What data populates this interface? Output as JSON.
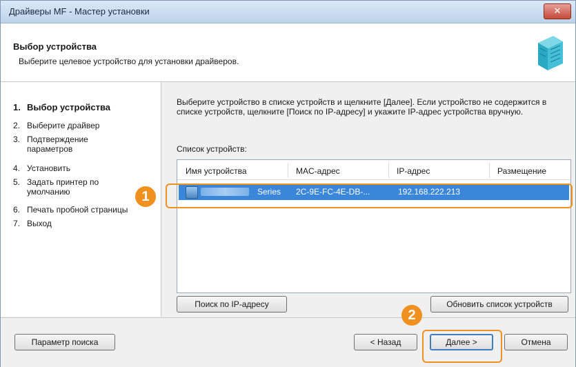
{
  "window": {
    "title": "Драйверы MF - Мастер установки",
    "close_label": "✕"
  },
  "header": {
    "title": "Выбор устройства",
    "subtitle": "Выберите целевое устройство для установки драйверов."
  },
  "steps": [
    {
      "num": "1.",
      "label": "Выбор устройства"
    },
    {
      "num": "2.",
      "label": "Выберите драйвер"
    },
    {
      "num": "3.",
      "label": "Подтверждение параметров"
    },
    {
      "num": "4.",
      "label": "Установить"
    },
    {
      "num": "5.",
      "label": "Задать принтер по умолчанию"
    },
    {
      "num": "6.",
      "label": "Печать пробной страницы"
    },
    {
      "num": "7.",
      "label": "Выход"
    }
  ],
  "content": {
    "instructions": "Выберите устройство в списке устройств и щелкните [Далее]. Если устройство не содержится в списке устройств, щелкните [Поиск по IP-адресу] и укажите IP-адрес устройства вручную.",
    "list_label": "Список устройств:",
    "columns": [
      "Имя устройства",
      "MAC-адрес",
      "IP-адрес",
      "Размещение"
    ],
    "rows": [
      {
        "name": "Series",
        "mac": "2C-9E-FC-4E-DB-...",
        "ip": "192.168.222.213",
        "location": ""
      }
    ],
    "search_ip_button": "Поиск по IP-адресу",
    "refresh_button": "Обновить список устройств"
  },
  "footer": {
    "search_params_button": "Параметр поиска",
    "back_button": "< Назад",
    "next_button": "Далее >",
    "cancel_button": "Отмена"
  },
  "callouts": {
    "one": "1",
    "two": "2"
  },
  "colors": {
    "accent": "#f0901e",
    "selection": "#3a86d8"
  }
}
